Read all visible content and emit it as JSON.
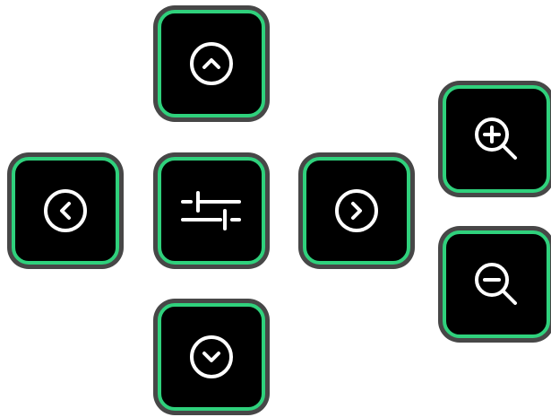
{
  "colors": {
    "button_fill": "#000000",
    "button_frame": "#474747",
    "accent_border": "#2fd17c",
    "icon_stroke": "#ffffff",
    "background": "#ffffff"
  },
  "controls": [
    {
      "id": "pan-up",
      "icon": "chevron-up-circle-icon"
    },
    {
      "id": "pan-left",
      "icon": "chevron-left-circle-icon"
    },
    {
      "id": "settings",
      "icon": "sliders-icon"
    },
    {
      "id": "pan-right",
      "icon": "chevron-right-circle-icon"
    },
    {
      "id": "pan-down",
      "icon": "chevron-down-circle-icon"
    },
    {
      "id": "zoom-in",
      "icon": "zoom-in-icon"
    },
    {
      "id": "zoom-out",
      "icon": "zoom-out-icon"
    }
  ]
}
